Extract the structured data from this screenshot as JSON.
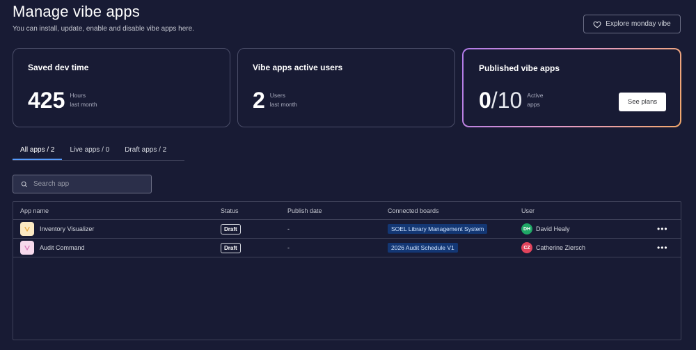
{
  "header": {
    "title": "Manage vibe apps",
    "subtitle": "You can install, update, enable and disable vibe apps here.",
    "explore_label": "Explore monday vibe",
    "explore_icon": "heart-icon"
  },
  "cards": [
    {
      "title": "Saved dev time",
      "value": "425",
      "caption_top": "Hours",
      "caption_bottom": "last month"
    },
    {
      "title": "Vibe apps active users",
      "value": "2",
      "caption_top": "Users",
      "caption_bottom": "last month"
    },
    {
      "title": "Published vibe apps",
      "value_main": "0",
      "value_rest": "/10",
      "caption_top": "Active",
      "caption_bottom": "apps",
      "button_label": "See plans"
    }
  ],
  "tabs": [
    {
      "label": "All apps / 2",
      "active": true
    },
    {
      "label": "Live apps / 0",
      "active": false
    },
    {
      "label": "Draft apps / 2",
      "active": false
    }
  ],
  "search": {
    "placeholder": "Search app",
    "icon": "search-icon"
  },
  "table": {
    "columns": [
      "App name",
      "Status",
      "Publish date",
      "Connected boards",
      "User"
    ],
    "rows": [
      {
        "app_name": "Inventory Visualizer",
        "icon_bg": "#fbe9c2",
        "icon_color": "#e8a73a",
        "status": "Draft",
        "publish_date": "-",
        "board": "SOEL Library Management System",
        "user_initials": "DH",
        "user_name": "David Healy",
        "avatar_color": "#1fa866",
        "menu": "•••"
      },
      {
        "app_name": "Audit Command",
        "icon_bg": "#f7d9ec",
        "icon_color": "#d974b7",
        "status": "Draft",
        "publish_date": "-",
        "board": "2026 Audit Schedule V1",
        "user_initials": "CZ",
        "user_name": "Catherine Ziersch",
        "avatar_color": "#e2445c",
        "menu": "•••"
      }
    ]
  },
  "colors": {
    "background": "#181b34",
    "accent": "#579bfc",
    "chip_bg": "#133774"
  }
}
